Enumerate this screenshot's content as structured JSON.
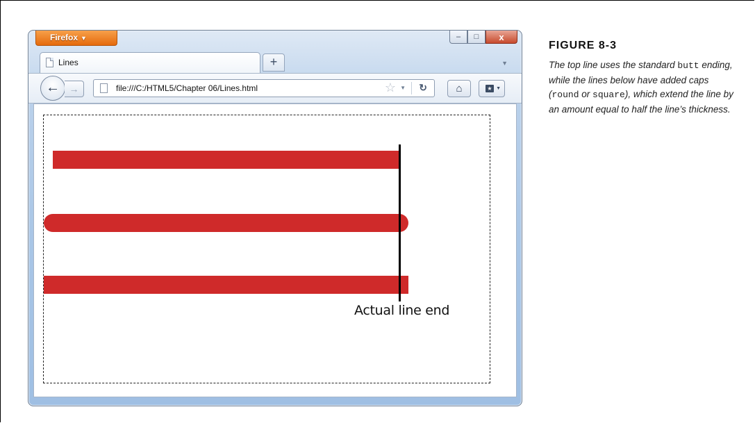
{
  "browser": {
    "app_button": "Firefox",
    "tab": {
      "label": "Lines"
    },
    "new_tab_label": "+",
    "url": "file:///C:/HTML5/Chapter 06/Lines.html",
    "controls": {
      "minimize": "–",
      "maximize": "□",
      "close": "x"
    }
  },
  "canvas": {
    "lines": [
      {
        "cap": "butt",
        "color": "#cf2a2a"
      },
      {
        "cap": "round",
        "color": "#cf2a2a"
      },
      {
        "cap": "square",
        "color": "#cf2a2a"
      }
    ],
    "marker_label": "Actual line end"
  },
  "figure": {
    "title": "FIGURE 8-3",
    "caption_parts": {
      "p1": "The top line uses the standard ",
      "code1": "butt",
      "p2": " ending, while the lines below have added caps (",
      "code2": "round",
      "p3": " or ",
      "code3": "square",
      "p4": "), which extend the line by an amount equal to half the line’s thickness."
    }
  }
}
